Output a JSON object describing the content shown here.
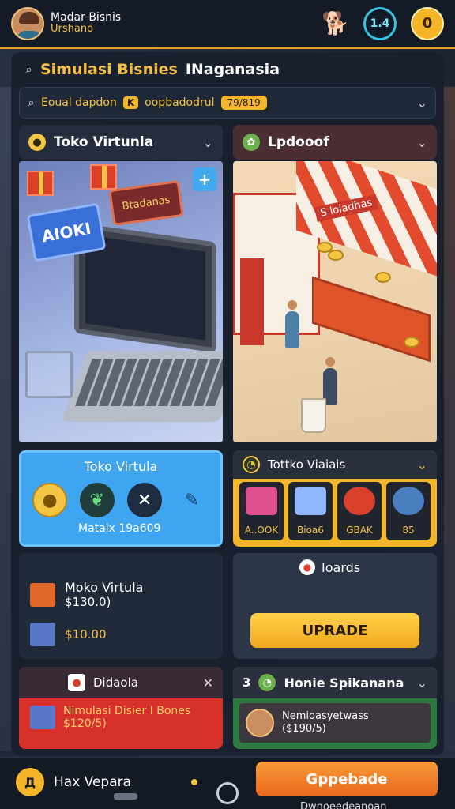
{
  "header": {
    "player_name": "Madar Bisnis",
    "player_sub": "Urshano",
    "badge_value": "1.4",
    "gold_value": "0"
  },
  "title_row": {
    "part1": "Simulasi Bisnies",
    "part2": "INaganasia"
  },
  "search": {
    "text": "Eoual dapdon",
    "key_badge": "K",
    "text2": "oopbadodrul",
    "yellow_badge": "79/819"
  },
  "cards": {
    "left_scene": {
      "title": "Toko Virtunla",
      "sign_blue": "AIOKI",
      "sign_red": "Btadanas",
      "plus": "+"
    },
    "right_scene": {
      "title": "Lpdooof",
      "shop_sign": "S loiadhas"
    },
    "blue_card": {
      "title": "Toko Virtula",
      "footer": "Matalx 19a609"
    },
    "dark_card": {
      "title": "Tottko Viaiais",
      "tiles": [
        {
          "caption": "A..OOK",
          "color": "#e05090"
        },
        {
          "caption": "Bioa6",
          "color": "#8fb6ff"
        },
        {
          "caption": "GBAK",
          "color": "#d8402c"
        },
        {
          "caption": "85",
          "color": "#4a7fc0"
        }
      ]
    },
    "list_card": {
      "item1_name": "Moko Virtula",
      "item1_price": "$130.0)",
      "item2_price": "$10.00"
    },
    "upgrade_card": {
      "header": "Ioards",
      "button": "UPRADE"
    },
    "red_card": {
      "title": "Didaola",
      "line1": "Nimulasi Disier I Bones",
      "line2": "$120/5)"
    },
    "green_card": {
      "prefix": "3",
      "title": "Honie Spikanana",
      "profile_line1": "Nemioasyetwass",
      "profile_line2": "($190/5)"
    }
  },
  "bottom": {
    "logo": "Д",
    "left_text": "Hax Vepara",
    "button": "Gppebade",
    "under_text": "Dwnoeedeanoan"
  },
  "colors": {
    "accent": "#f4b52a",
    "cyan": "#35c3de",
    "blue_card": "#3fa5f0",
    "red_card": "#d8302a",
    "green_card": "#2d7a40",
    "button_orange": "#e9681c"
  }
}
